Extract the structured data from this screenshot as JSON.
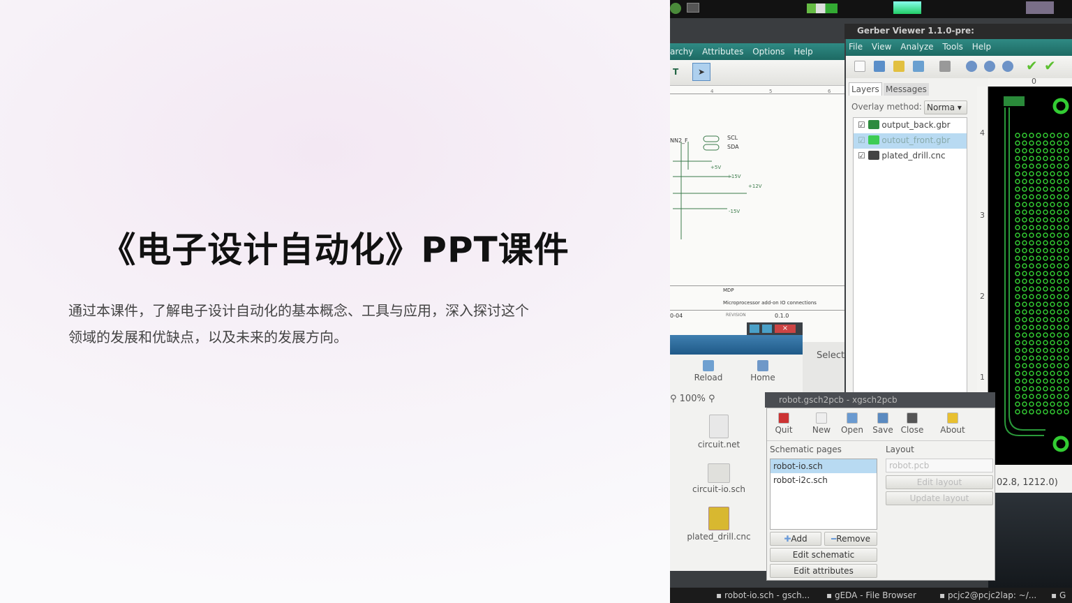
{
  "slide": {
    "title": "《电子设计自动化》PPT课件",
    "subtitle_lines": [
      "通过本课件，了解电子设计自动化的基本概念、工具与应用，深入探讨这个",
      "领域的发展和优缺点，以及未来的发展方向。"
    ]
  },
  "screenshot": {
    "schematic_window": {
      "menu": [
        "archy",
        "Attributes",
        "Options",
        "Help"
      ],
      "ruler_ticks": [
        "4",
        "5",
        "6"
      ],
      "net_labels": [
        "NN2_F",
        "SCL",
        "SDA",
        "+5V",
        "+15V",
        "+12V",
        "-15V"
      ],
      "title_block": {
        "code": "MDP",
        "description": "Microprocessor add-on IO connections",
        "doc": "0-04",
        "revision_label": "REVISION",
        "revision": "0.1.0"
      },
      "select_text": "Select"
    },
    "gerber_viewer": {
      "title": "Gerber Viewer 1.1.0-pre:",
      "menu": [
        "File",
        "View",
        "Analyze",
        "Tools",
        "Help"
      ],
      "tabs": [
        "Layers",
        "Messages"
      ],
      "overlay_label": "Overlay method:",
      "overlay_value": "Norma",
      "layers": [
        {
          "name": "output_back.gbr",
          "color": "#2e8b3e",
          "checked": true,
          "selected": false
        },
        {
          "name": "outout_front.gbr",
          "color": "#3dcc55",
          "checked": true,
          "selected": true
        },
        {
          "name": "plated_drill.cnc",
          "color": "#444444",
          "checked": true,
          "selected": false
        }
      ],
      "ruler_top": "0",
      "ruler_left": [
        "4",
        "3",
        "2",
        "1"
      ],
      "coordinates": "02.8,  1212.0)"
    },
    "file_browser": {
      "toolbar": [
        "Reload",
        "Home"
      ],
      "zoom": "100%",
      "files": [
        "circuit.net",
        "circuit-io.sch",
        "plated_drill.cnc"
      ]
    },
    "xgsch2pcb": {
      "title": "robot.gsch2pcb - xgsch2pcb",
      "toolbar": [
        "Quit",
        "New",
        "Open",
        "Save",
        "Close",
        "About"
      ],
      "schematic_label": "Schematic pages",
      "schematic_pages": [
        "robot-io.sch",
        "robot-i2c.sch"
      ],
      "layout_label": "Layout",
      "layout_value": "robot.pcb",
      "buttons": {
        "add": "Add",
        "remove": "Remove",
        "edit_schematic": "Edit schematic",
        "edit_attributes": "Edit attributes",
        "edit_layout": "Edit layout",
        "update_layout": "Update layout"
      }
    },
    "taskbar": [
      "robot-io.sch - gsch...",
      "gEDA - File Browser",
      "pcjc2@pcjc2lap: ~/...",
      "G"
    ]
  }
}
